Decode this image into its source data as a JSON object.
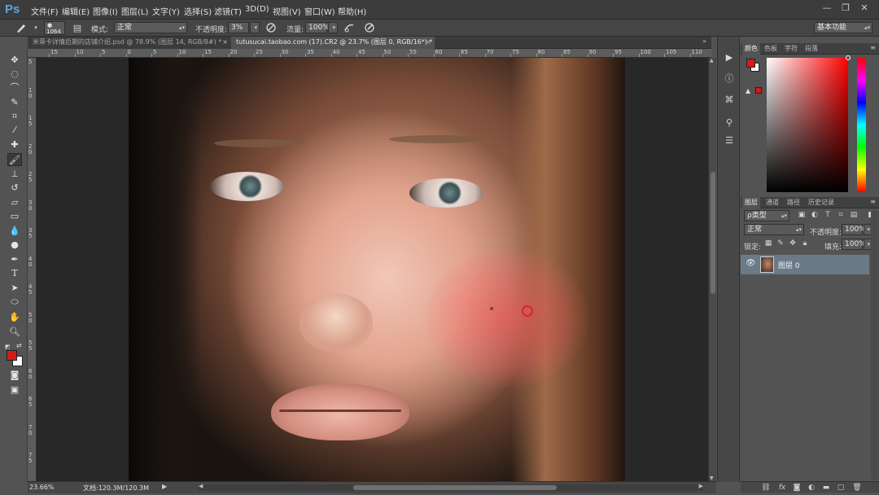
{
  "app": {
    "logo": "Ps"
  },
  "menu": {
    "items": [
      "文件(F)",
      "编辑(E)",
      "图像(I)",
      "图层(L)",
      "文字(Y)",
      "选择(S)",
      "滤镜(T)",
      "3D(D)",
      "视图(V)",
      "窗口(W)",
      "帮助(H)"
    ]
  },
  "window_controls": {
    "minimize": "—",
    "restore": "❐",
    "close": "✕"
  },
  "options": {
    "brush_size": "1064",
    "mode_label": "模式:",
    "mode_value": "正常",
    "opacity_label": "不透明度:",
    "opacity_value": "3%",
    "flow_label": "流量:",
    "flow_value": "100%",
    "workspace": "基本功能"
  },
  "tabs": [
    {
      "label": "米蒂卡详情后期的店铺介绍.psd @ 78.9% (图层 14, RGB/8#) *",
      "active": false
    },
    {
      "label": "tutusucai.taobao.com (17).CR2 @ 23.7% (图层 0, RGB/16*) *",
      "active": true
    }
  ],
  "ruler_top": [
    "15",
    "10",
    "5",
    "0",
    "5",
    "10",
    "15",
    "20",
    "25",
    "30",
    "35",
    "40",
    "45",
    "50",
    "55",
    "60",
    "65",
    "70",
    "75",
    "80",
    "85",
    "90",
    "95",
    "100",
    "105",
    "110",
    "115"
  ],
  "ruler_left": [
    "5",
    "10",
    "15",
    "20",
    "25",
    "30",
    "35",
    "40",
    "45",
    "50",
    "55",
    "60",
    "65",
    "70",
    "75"
  ],
  "status": {
    "zoom": "23.66%",
    "doc_info": "文档:120.3M/120.3M"
  },
  "color_panel": {
    "tabs": [
      "颜色",
      "色板",
      "字符",
      "段落"
    ],
    "foreground": "#d51a1a",
    "background": "#ffffff"
  },
  "layers_panel": {
    "tabs": [
      "图层",
      "通道",
      "路径",
      "历史记录"
    ],
    "filter_kind": "ρ类型",
    "blend_mode": "正常",
    "opacity_label": "不透明度:",
    "opacity_value": "100%",
    "lock_label": "锁定:",
    "fill_label": "填充:",
    "fill_value": "100%",
    "layers": [
      {
        "name": "图层 0",
        "visible": true,
        "selected": true
      }
    ]
  },
  "panel_bottom_icons": [
    "link-icon",
    "fx-icon",
    "mask-icon",
    "adjustment-icon",
    "group-icon",
    "new-layer-icon",
    "trash-icon"
  ]
}
